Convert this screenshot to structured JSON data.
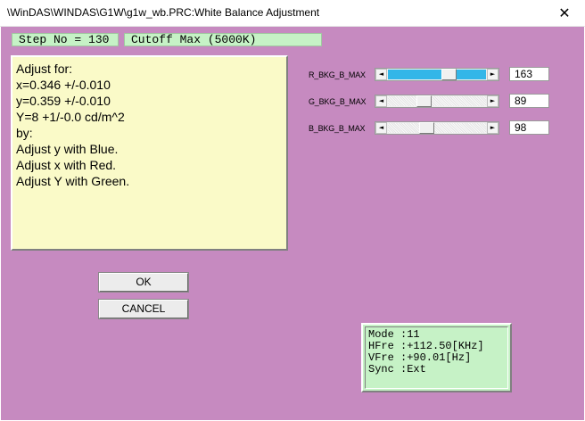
{
  "window": {
    "title": "\\WinDAS\\WINDAS\\G1W\\g1w_wb.PRC:White Balance Adjustment",
    "close_glyph": "✕"
  },
  "header": {
    "step": "Step No = 130",
    "cutoff": "Cutoff Max (5000K)"
  },
  "instructions": [
    "Adjust for:",
    "x=0.346 +/-0.010",
    "y=0.359 +/-0.010",
    "Y=8 +1/-0.0 cd/m^2",
    "by:",
    "Adjust y with Blue.",
    "Adjust x with Red.",
    "Adjust Y with Green."
  ],
  "sliders": [
    {
      "label": "R_BKG_B_MAX",
      "value": "163",
      "level": 0.64,
      "active": true
    },
    {
      "label": "G_BKG_B_MAX",
      "value": "89",
      "level": 0.35,
      "active": false
    },
    {
      "label": "B_BKG_B_MAX",
      "value": "98",
      "level": 0.38,
      "active": false
    }
  ],
  "buttons": {
    "ok": "OK",
    "cancel": "CANCEL"
  },
  "status": {
    "mode": "Mode :11",
    "hfre": "HFre :+112.50[KHz]",
    "vfre": "VFre :+90.01[Hz]",
    "sync": "Sync :Ext"
  },
  "colors": {
    "client_bg": "#c68ac0",
    "instruction_bg": "#fafac8",
    "status_bg": "#c6f2c6",
    "slider_active": "#33b6e8"
  },
  "icons": {
    "arrow_left": "◄",
    "arrow_right": "►"
  }
}
